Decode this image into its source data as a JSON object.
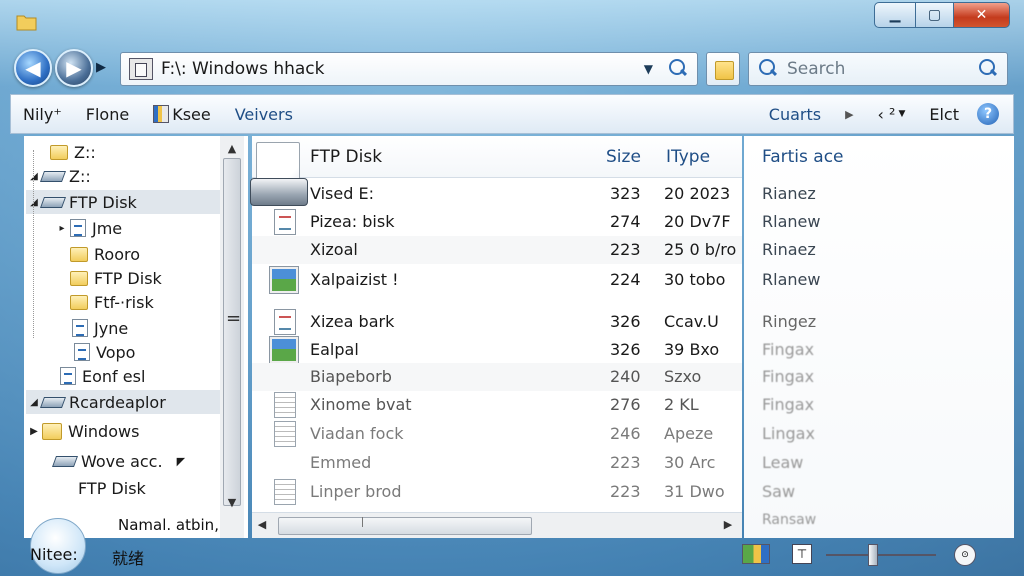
{
  "address": {
    "path": "F:\\: Windows hhack"
  },
  "search": {
    "placeholder": "Search"
  },
  "toolbar": {
    "items": [
      "Nily⁺",
      "Flone",
      "Ksee",
      "Veivers"
    ],
    "right": [
      "Cuarts",
      "‹ ²",
      "Elct"
    ]
  },
  "tree": {
    "items": [
      {
        "label": "Z::",
        "icon": "folder-icon"
      },
      {
        "label": "Z::",
        "icon": "drive-icon"
      },
      {
        "label": "FTP Disk",
        "icon": "drive-icon"
      },
      {
        "label": "Jme",
        "icon": "document-icon"
      },
      {
        "label": "Rooro",
        "icon": "folder-icon"
      },
      {
        "label": "FTP Disk",
        "icon": "folder-icon"
      },
      {
        "label": "Ftf-·risk",
        "icon": "folder-icon"
      },
      {
        "label": "Jyne",
        "icon": "document-icon"
      },
      {
        "label": "Vopo",
        "icon": "document-icon"
      },
      {
        "label": "Eonf esl",
        "icon": "document-icon"
      },
      {
        "label": "Rcardeaplor",
        "icon": "drive-icon"
      },
      {
        "label": "Windows",
        "icon": "folder-icon"
      },
      {
        "label": "Wove acc.",
        "icon": "drive-icon"
      },
      {
        "label": "FTP Disk",
        "icon": "none"
      }
    ]
  },
  "files": {
    "columns": {
      "name": "FTP Disk",
      "size": "Size",
      "type": "IType",
      "extra": "Fartis ace"
    },
    "rows": [
      {
        "name": "Vised E:",
        "size": "323",
        "type": "20 2023",
        "extra": "Rianez",
        "icon": "drive-icon"
      },
      {
        "name": "Pizea: bisk",
        "size": "274",
        "type": "20 Dv7F",
        "extra": "Rlanew",
        "icon": "document-icon"
      },
      {
        "name": "Xizoal",
        "size": "223",
        "type": "25 0 b/ro",
        "extra": "Rinaez",
        "icon": "none"
      },
      {
        "name": "Xalpaizist !",
        "size": "224",
        "type": "30 tobo",
        "extra": "Rlanew",
        "icon": "picture-icon"
      },
      {
        "name": "Xizea bark",
        "size": "326",
        "type": "Ccav.U",
        "extra": "Ringez",
        "icon": "document-icon"
      },
      {
        "name": "Ealpal",
        "size": "326",
        "type": "39 Bxo",
        "extra": "Fingax",
        "icon": "picture-icon"
      },
      {
        "name": "Biapeborb",
        "size": "240",
        "type": "Szxo",
        "extra": "Fingax",
        "icon": "none"
      },
      {
        "name": "Xinome bvat",
        "size": "276",
        "type": "2 KL",
        "extra": "Fingax",
        "icon": "text-icon"
      },
      {
        "name": "Viadan fock",
        "size": "246",
        "type": "Apeze",
        "extra": "Lingax",
        "icon": "text-icon"
      },
      {
        "name": "Emmed",
        "size": "223",
        "type": "30 Arc",
        "extra": "Leaw",
        "icon": "none"
      },
      {
        "name": "Linper brod",
        "size": "223",
        "type": "31 Dwo",
        "extra": "Saw",
        "icon": "text-icon"
      },
      {
        "name": "",
        "size": "",
        "type": "",
        "extra": "Ransaw",
        "icon": "none"
      }
    ]
  },
  "status": {
    "line1": "Namal. atbin,",
    "left_label": "Nitee:",
    "left_value": "就绪"
  }
}
